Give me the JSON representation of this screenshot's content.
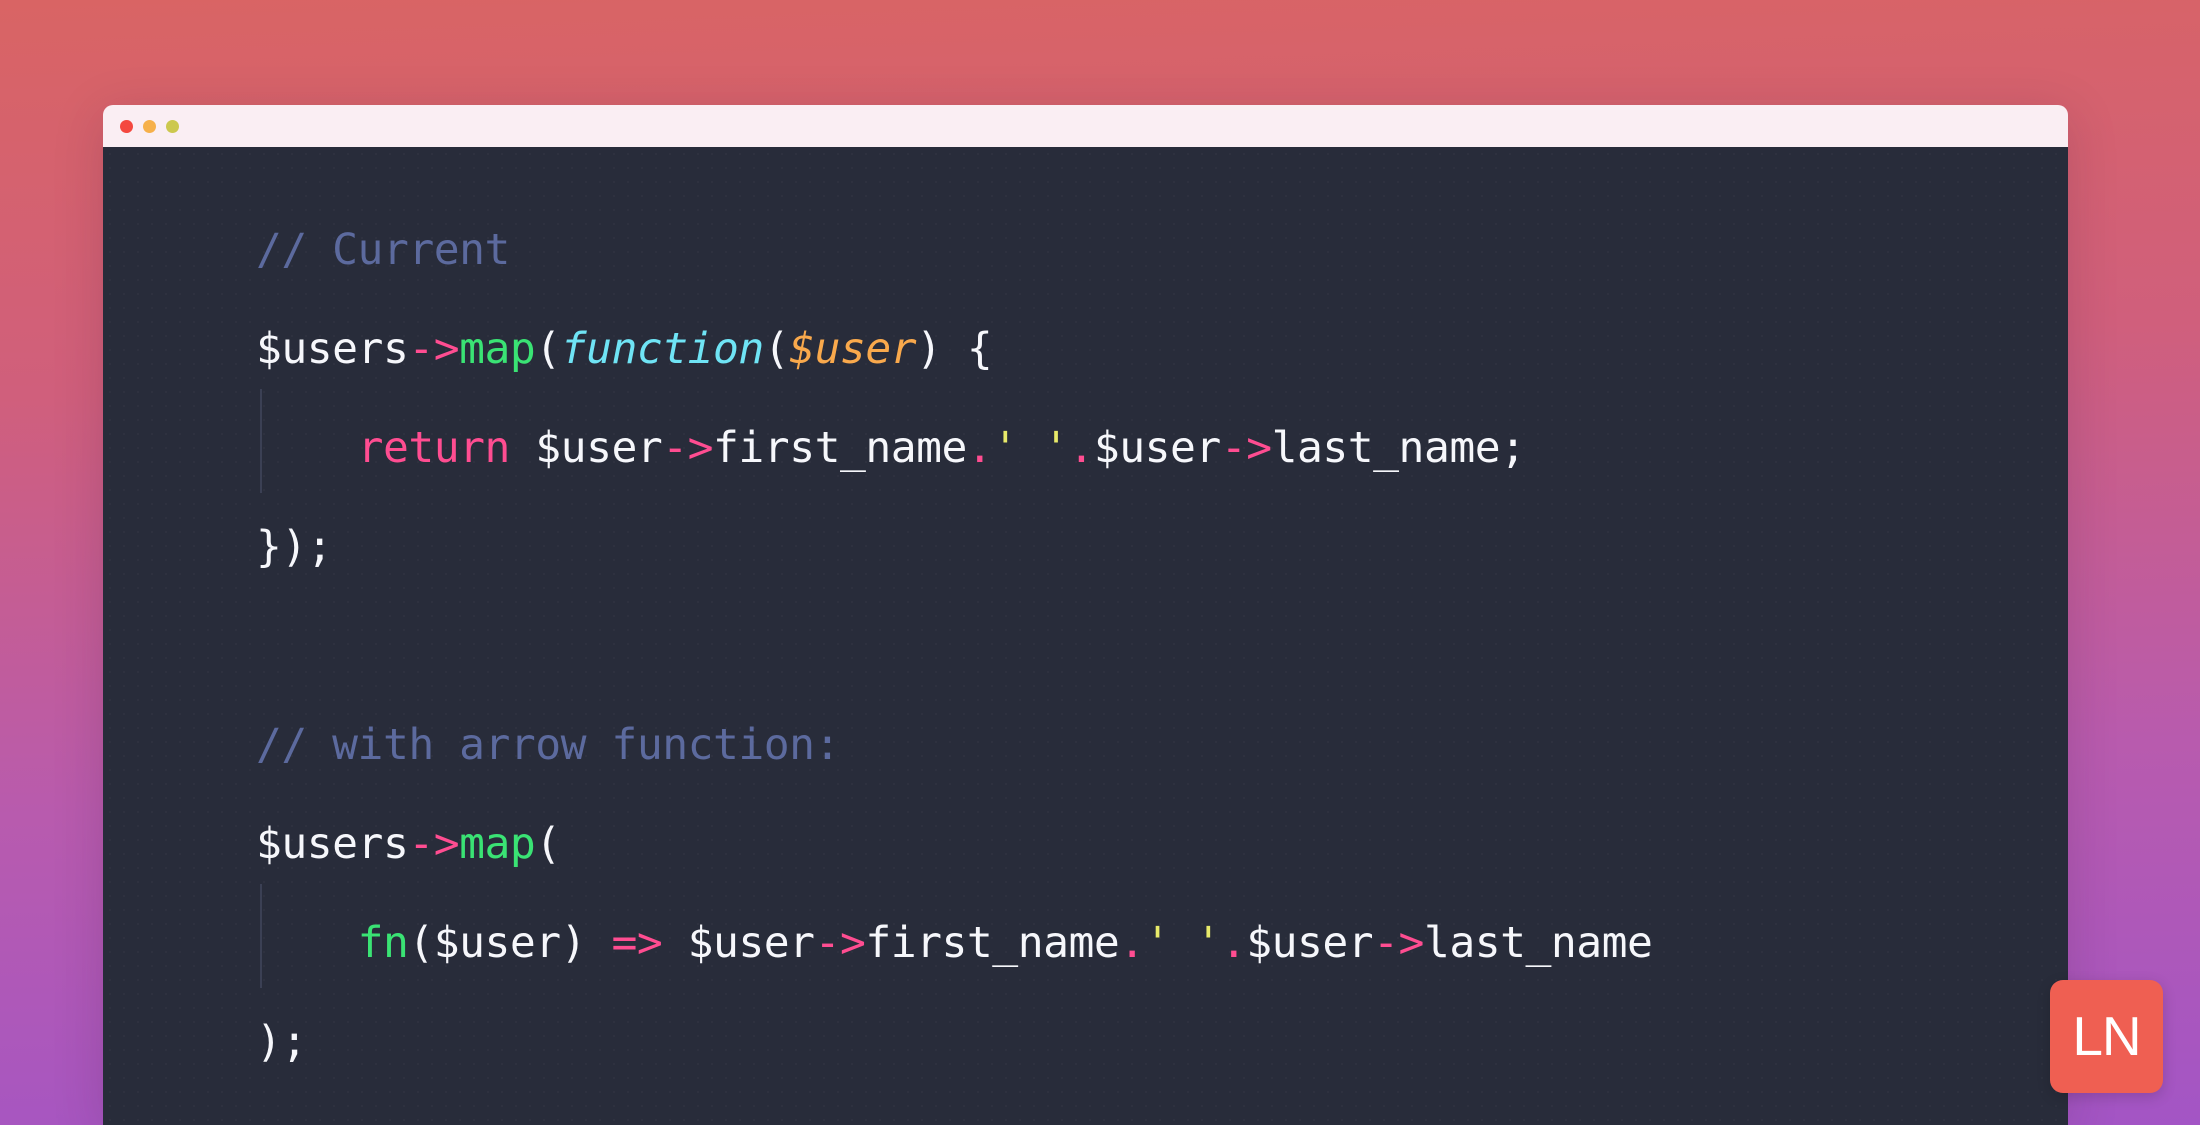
{
  "background": {
    "gradient_from": "#d96464",
    "gradient_to": "#a355c5"
  },
  "window": {
    "titlebar_color": "#faeef3",
    "editor_background": "#282c3a",
    "controls": [
      {
        "name": "close",
        "color": "#f4483f"
      },
      {
        "name": "minimize",
        "color": "#f6b04a"
      },
      {
        "name": "maximize",
        "color": "#ccc84e"
      }
    ]
  },
  "code": {
    "language": "php",
    "theme_colors": {
      "comment": "#5c6a9e",
      "plain": "#f6f7fb",
      "arrow_operator": "#ff4d91",
      "method": "#3ae374",
      "keyword": "#ff4d91",
      "type": "#6fe4f5",
      "variable": "#f9a94c",
      "string": "#e8ea6a",
      "concat_dot": "#ff4d91"
    },
    "lines": [
      {
        "id": "l1",
        "indent": false,
        "tokens": [
          {
            "text": "// Current",
            "cls": "t-comment"
          }
        ]
      },
      {
        "id": "l2",
        "indent": false,
        "tokens": [
          {
            "text": "$users",
            "cls": "t-plain"
          },
          {
            "text": "->",
            "cls": "t-arrow"
          },
          {
            "text": "map",
            "cls": "t-method"
          },
          {
            "text": "(",
            "cls": "t-punct"
          },
          {
            "text": "function",
            "cls": "t-type"
          },
          {
            "text": "(",
            "cls": "t-punct"
          },
          {
            "text": "$user",
            "cls": "t-var"
          },
          {
            "text": ") {",
            "cls": "t-punct"
          }
        ]
      },
      {
        "id": "l3",
        "indent": true,
        "tokens": [
          {
            "text": "    ",
            "cls": "t-plain"
          },
          {
            "text": "return",
            "cls": "t-keyword"
          },
          {
            "text": " $user",
            "cls": "t-plain"
          },
          {
            "text": "->",
            "cls": "t-arrow"
          },
          {
            "text": "first_name",
            "cls": "t-plain"
          },
          {
            "text": ".",
            "cls": "t-dot"
          },
          {
            "text": "' '",
            "cls": "t-string"
          },
          {
            "text": ".",
            "cls": "t-dot"
          },
          {
            "text": "$user",
            "cls": "t-plain"
          },
          {
            "text": "->",
            "cls": "t-arrow"
          },
          {
            "text": "last_name;",
            "cls": "t-plain"
          }
        ]
      },
      {
        "id": "l4",
        "indent": false,
        "tokens": [
          {
            "text": "});",
            "cls": "t-punct"
          }
        ]
      },
      {
        "id": "l5",
        "indent": false,
        "tokens": [
          {
            "text": "",
            "cls": "t-plain"
          }
        ]
      },
      {
        "id": "l6",
        "indent": false,
        "tokens": [
          {
            "text": "// with arrow function:",
            "cls": "t-comment"
          }
        ]
      },
      {
        "id": "l7",
        "indent": false,
        "tokens": [
          {
            "text": "$users",
            "cls": "t-plain"
          },
          {
            "text": "->",
            "cls": "t-arrow"
          },
          {
            "text": "map",
            "cls": "t-method"
          },
          {
            "text": "(",
            "cls": "t-punct"
          }
        ]
      },
      {
        "id": "l8",
        "indent": true,
        "tokens": [
          {
            "text": "    ",
            "cls": "t-plain"
          },
          {
            "text": "fn",
            "cls": "t-kw-fn"
          },
          {
            "text": "($user) ",
            "cls": "t-plain"
          },
          {
            "text": "=>",
            "cls": "t-keyword"
          },
          {
            "text": " $user",
            "cls": "t-plain"
          },
          {
            "text": "->",
            "cls": "t-arrow"
          },
          {
            "text": "first_name",
            "cls": "t-plain"
          },
          {
            "text": ".",
            "cls": "t-dot"
          },
          {
            "text": "' '",
            "cls": "t-string"
          },
          {
            "text": ".",
            "cls": "t-dot"
          },
          {
            "text": "$user",
            "cls": "t-plain"
          },
          {
            "text": "->",
            "cls": "t-arrow"
          },
          {
            "text": "last_name",
            "cls": "t-plain"
          }
        ]
      },
      {
        "id": "l9",
        "indent": false,
        "tokens": [
          {
            "text": ");",
            "cls": "t-punct"
          }
        ]
      }
    ]
  },
  "badge": {
    "label": "LN",
    "background": "#ef5f52",
    "text_color": "#ffffff"
  }
}
